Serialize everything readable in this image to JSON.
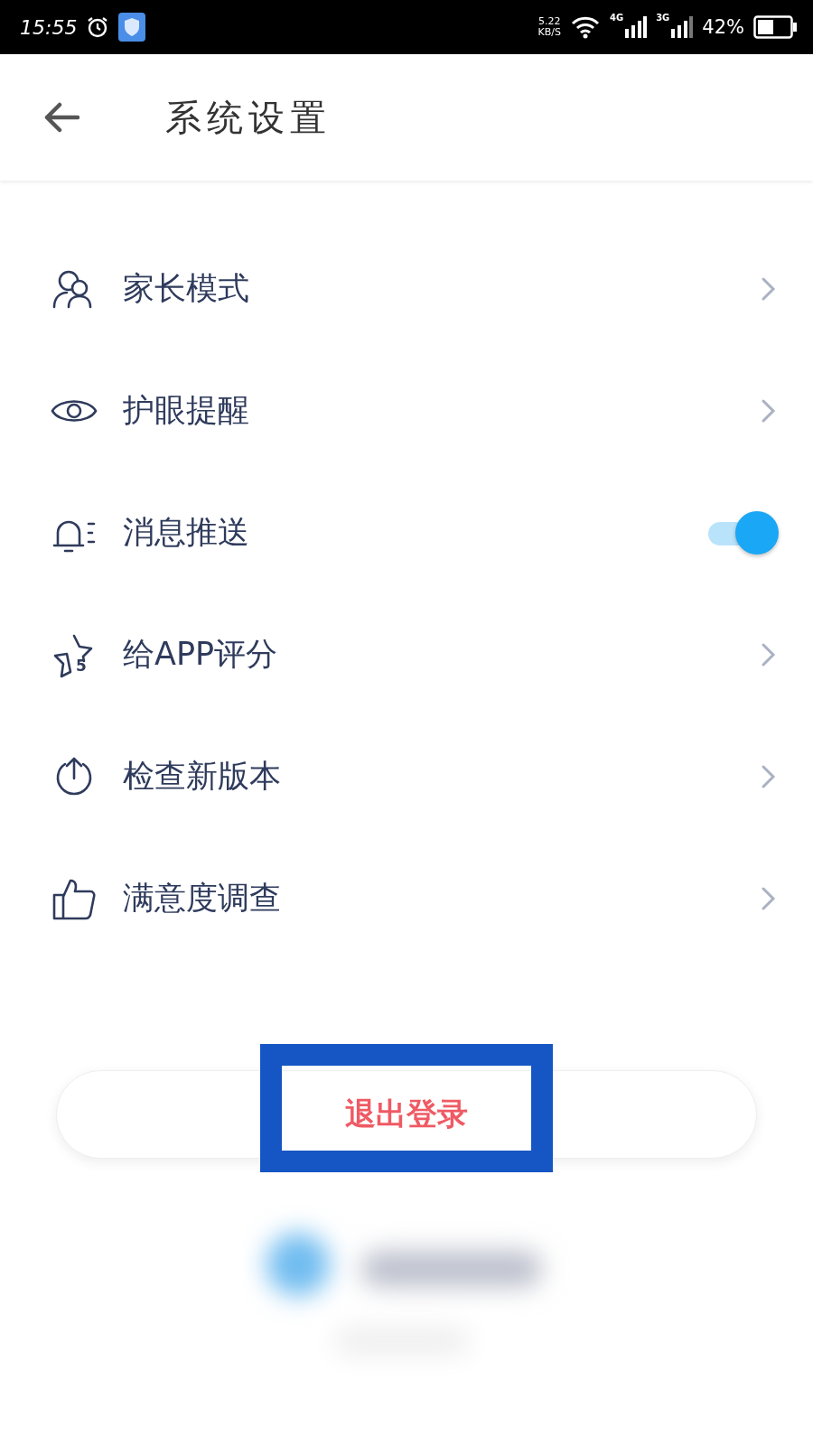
{
  "status_bar": {
    "time": "15:55",
    "speed": "5.22",
    "speed_unit": "KB/S",
    "network_1": "4G",
    "network_2": "3G",
    "battery": "42%"
  },
  "header": {
    "title": "系统设置"
  },
  "items": [
    {
      "kind": "link",
      "label": "家长模式"
    },
    {
      "kind": "link",
      "label": "护眼提醒"
    },
    {
      "kind": "toggle",
      "label": "消息推送",
      "on": true
    },
    {
      "kind": "link",
      "label": "给APP评分",
      "icon_text": "5"
    },
    {
      "kind": "link",
      "label": "检查新版本"
    },
    {
      "kind": "link",
      "label": "满意度调查"
    }
  ],
  "logout": {
    "label": "退出登录",
    "highlighted": true
  }
}
